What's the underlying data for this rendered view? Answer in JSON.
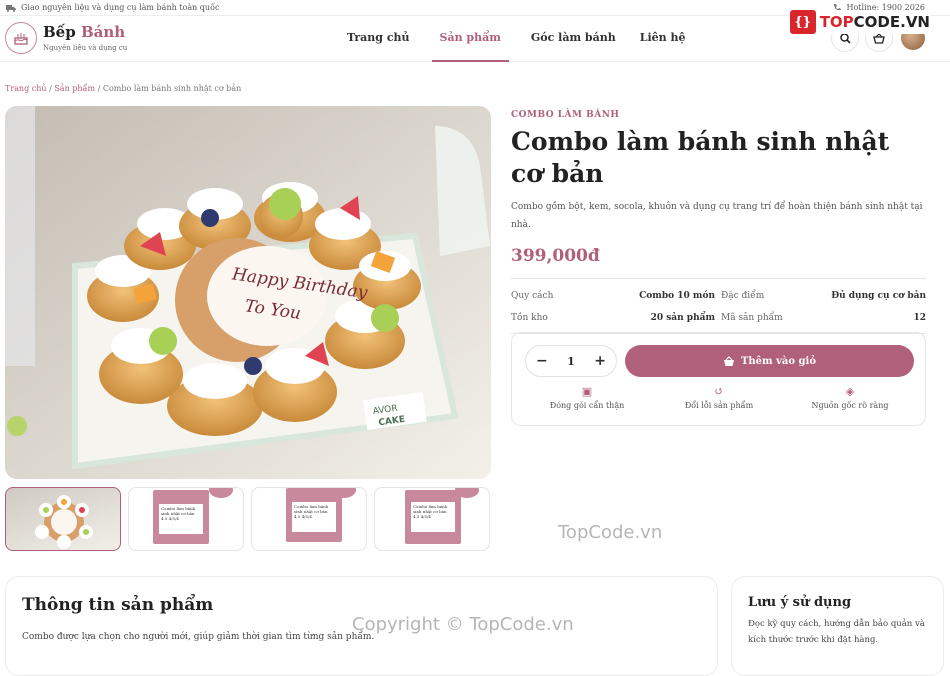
{
  "topbar": {
    "shipping_icon": "truck-icon",
    "shipping_text": "Giao nguyên liệu và dụng cụ làm bánh toàn quốc",
    "hotline_icon": "phone-icon",
    "hotline": "Hotline: 1900 2026"
  },
  "brand": {
    "icon": "cake-icon",
    "name_part1": "Bếp",
    "name_part2": "Bánh",
    "tagline": "Nguyên liệu và dụng cụ"
  },
  "nav": {
    "items": [
      "Trang chủ",
      "Sản phẩm",
      "Góc làm bánh",
      "Liên hệ"
    ],
    "active_index": 1
  },
  "header_icons": [
    "search-icon",
    "basket-icon",
    "avatar"
  ],
  "watermark": {
    "logo_text_a": "TOP",
    "logo_text_b": "CODE.VN",
    "center": "TopCode.vn",
    "bottom": "Copyright © TopCode.vn"
  },
  "breadcrumb": {
    "home": "Trang chủ",
    "products": "Sản phẩm",
    "current": "Combo làm bánh sinh nhật cơ bản",
    "separator": "/"
  },
  "image": {
    "cake_text_line1": "Happy Birthday",
    "cake_text_line2": "To You",
    "box_text_line1": "AVOR",
    "box_text_line2": "CAKE"
  },
  "thumbnails": [
    {
      "type": "photo",
      "label": "Happy Birthday To You"
    },
    {
      "type": "card",
      "line1": "Combo làm bánh",
      "line2": "sinh nhật cơ bản",
      "line3": "4.5 4/5/4"
    },
    {
      "type": "card",
      "line1": "Combo làm bánh",
      "line2": "sinh nhật cơ bản",
      "line3": "4.5 4/5/4"
    },
    {
      "type": "card",
      "line1": "Combo làm bánh",
      "line2": "sinh nhật cơ bản",
      "line3": "4.5 4/5/4"
    }
  ],
  "product": {
    "category": "COMBO LÀM BÁNH",
    "title": "Combo làm bánh sinh nhật cơ bản",
    "description": "Combo gồm bột, kem, socola, khuôn và dụng cụ trang trí để hoàn thiện bánh sinh nhật tại nhà.",
    "price": "399,000đ",
    "specs": [
      {
        "k1": "Quy cách",
        "v1": "Combo 10 món",
        "k2": "Đặc điểm",
        "v2": "Đủ dụng cụ cơ bản"
      },
      {
        "k1": "Tồn kho",
        "v1": "20 sản phẩm",
        "k2": "Mã sản phẩm",
        "v2": "12"
      }
    ]
  },
  "buy": {
    "minus": "−",
    "quantity": "1",
    "plus": "+",
    "cart_icon": "basket-icon",
    "add_to_cart": "Thêm vào giỏ",
    "features": [
      {
        "icon": "gift-icon",
        "label": "Đóng gói cẩn thận"
      },
      {
        "icon": "refresh-icon",
        "label": "Đổi lỗi sản phẩm"
      },
      {
        "icon": "shield-icon",
        "label": "Nguồn gốc rõ ràng"
      }
    ]
  },
  "info_section": {
    "title": "Thông tin sản phẩm",
    "text": "Combo được lựa chọn cho người mới, giúp giảm thời gian tìm từng sản phẩm."
  },
  "note_section": {
    "title": "Lưu ý sử dụng",
    "text": "Đọc kỹ quy cách, hướng dẫn bảo quản và kích thước trước khi đặt hàng."
  },
  "colors": {
    "accent": "#b0607a",
    "watermark_red": "#d9262c"
  }
}
